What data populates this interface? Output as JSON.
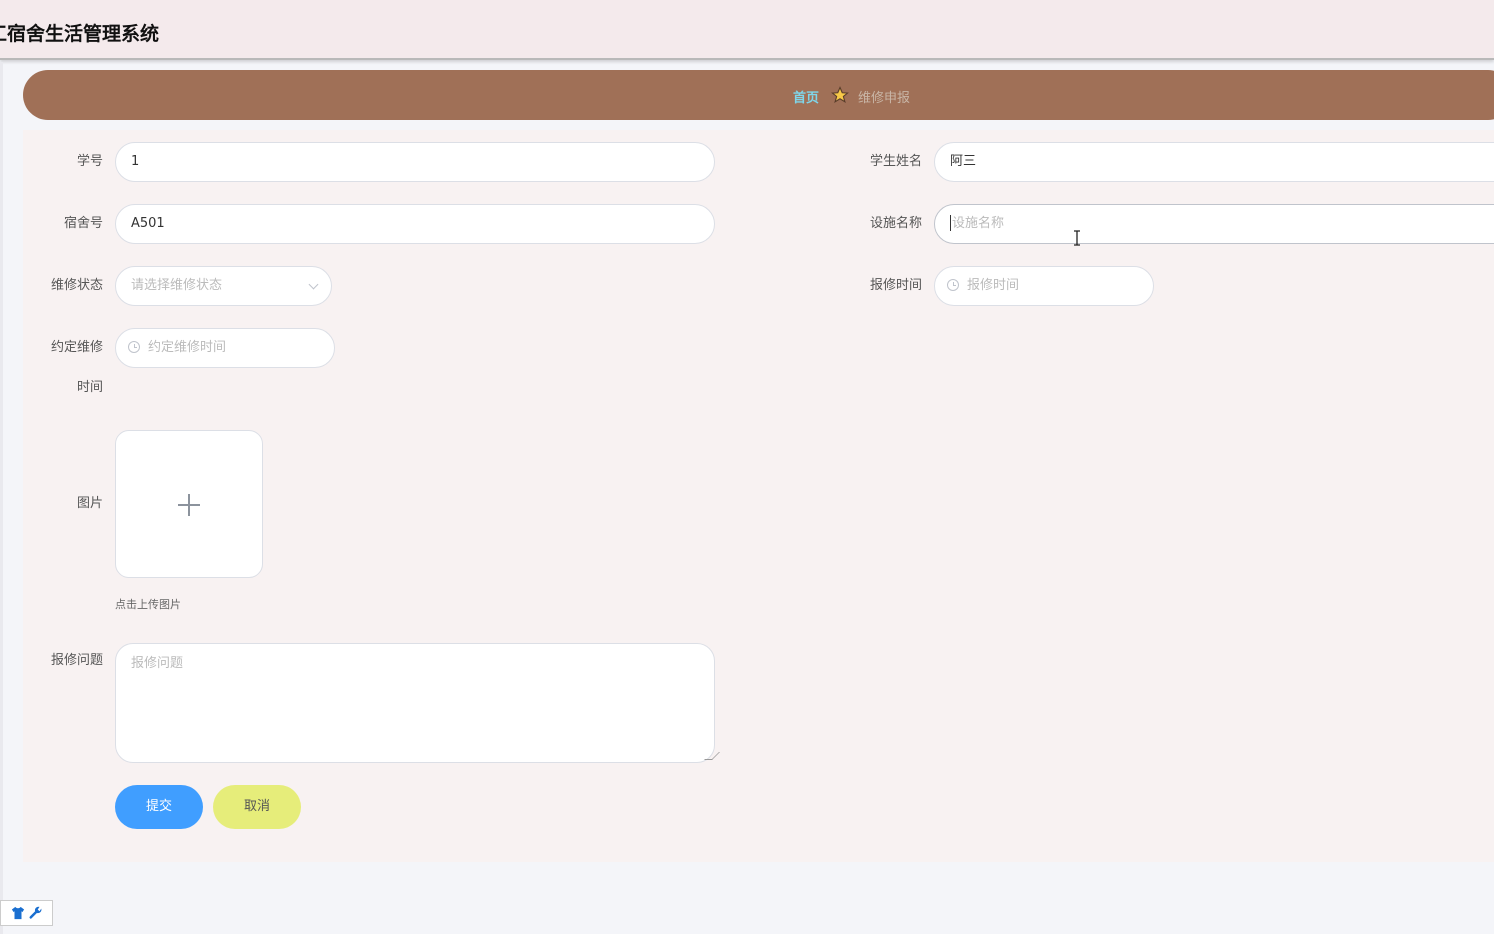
{
  "header": {
    "title": "工宿舍生活管理系统"
  },
  "breadcrumb": {
    "home": "首页",
    "current": "维修申报"
  },
  "form": {
    "student_no": {
      "label": "学号",
      "value": "1"
    },
    "student_name": {
      "label": "学生姓名",
      "value": "阿三"
    },
    "dorm_no": {
      "label": "宿舍号",
      "value": "A501"
    },
    "facility_name": {
      "label": "设施名称",
      "placeholder": "设施名称"
    },
    "repair_status": {
      "label": "维修状态",
      "placeholder": "请选择维修状态"
    },
    "report_time": {
      "label": "报修时间",
      "placeholder": "报修时间"
    },
    "appointment_time": {
      "label_line1": "约定维修",
      "label_line2": "时间",
      "placeholder": "约定维修时间"
    },
    "image": {
      "label": "图片",
      "hint": "点击上传图片"
    },
    "problem": {
      "label": "报修问题",
      "placeholder": "报修问题"
    }
  },
  "buttons": {
    "submit": "提交",
    "cancel": "取消"
  },
  "colors": {
    "breadcrumb_bg": "#a07057",
    "submit_bg": "#409eff",
    "cancel_bg": "#e6ed7a",
    "home_link": "#7fd6ea"
  }
}
